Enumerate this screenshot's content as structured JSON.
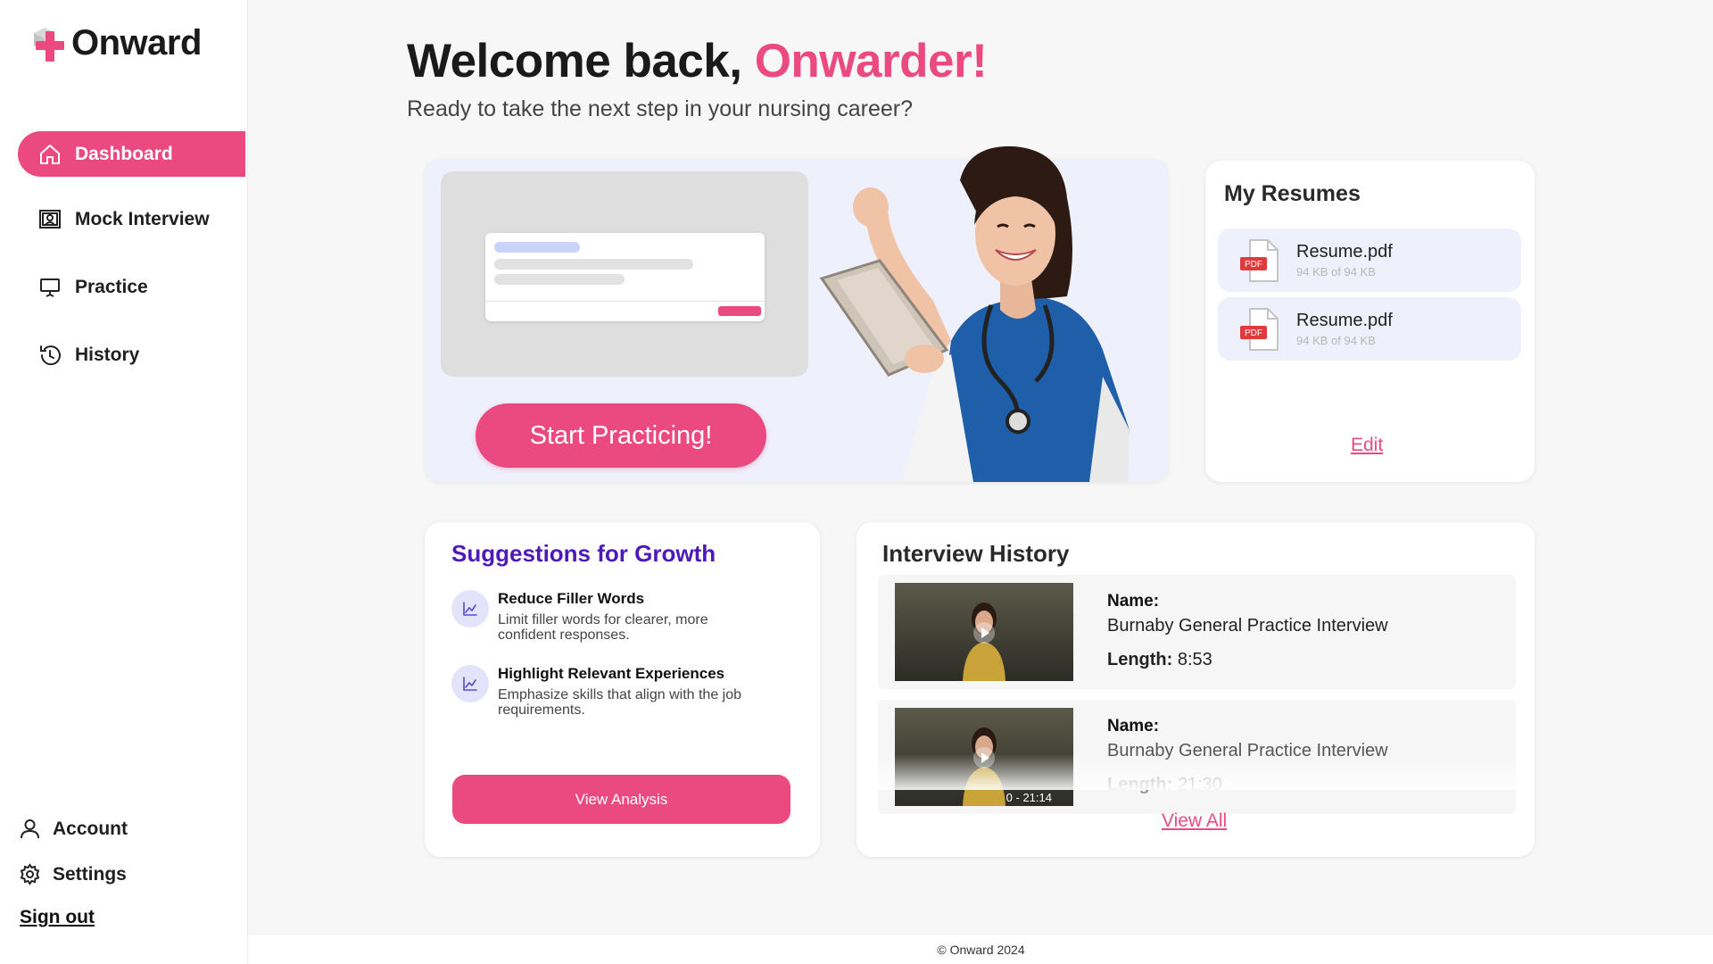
{
  "brand": {
    "name": "Onward",
    "accent": "#ea4a7f",
    "heading_purple": "#4d1ab8"
  },
  "sidebar": {
    "items": [
      {
        "label": "Dashboard",
        "icon": "home-icon",
        "active": true
      },
      {
        "label": "Mock Interview",
        "icon": "interview-icon",
        "active": false
      },
      {
        "label": "Practice",
        "icon": "presentation-icon",
        "active": false
      },
      {
        "label": "History",
        "icon": "history-icon",
        "active": false
      }
    ],
    "bottom": [
      {
        "label": "Account",
        "icon": "user-icon"
      },
      {
        "label": "Settings",
        "icon": "gear-icon"
      }
    ],
    "signout": "Sign out"
  },
  "header": {
    "welcome": "Welcome back, ",
    "name": "Onwarder!",
    "subtitle": "Ready to take the next step in your nursing career?"
  },
  "hero": {
    "button": "Start Practicing!"
  },
  "resumes": {
    "title": "My Resumes",
    "files": [
      {
        "name": "Resume.pdf",
        "size": "94 KB of 94 KB",
        "badge": "PDF"
      },
      {
        "name": "Resume.pdf",
        "size": "94 KB of 94 KB",
        "badge": "PDF"
      }
    ],
    "edit": "Edit"
  },
  "growth": {
    "title": "Suggestions for Growth",
    "items": [
      {
        "title": "Reduce Filler Words",
        "desc": "Limit filler words for clearer, more confident responses."
      },
      {
        "title": "Highlight Relevant Experiences",
        "desc": "Emphasize skills that align with the job requirements."
      }
    ],
    "button": "View Analysis"
  },
  "history": {
    "title": "Interview History",
    "name_label": "Name:",
    "length_label": "Length:",
    "rows": [
      {
        "name": "Burnaby General Practice Interview",
        "length": "8:53",
        "duration": ""
      },
      {
        "name": "Burnaby General Practice Interview",
        "length": "21:30",
        "duration": "0 - 21:14"
      }
    ],
    "view_all": "View All"
  },
  "footer": "© Onward 2024"
}
